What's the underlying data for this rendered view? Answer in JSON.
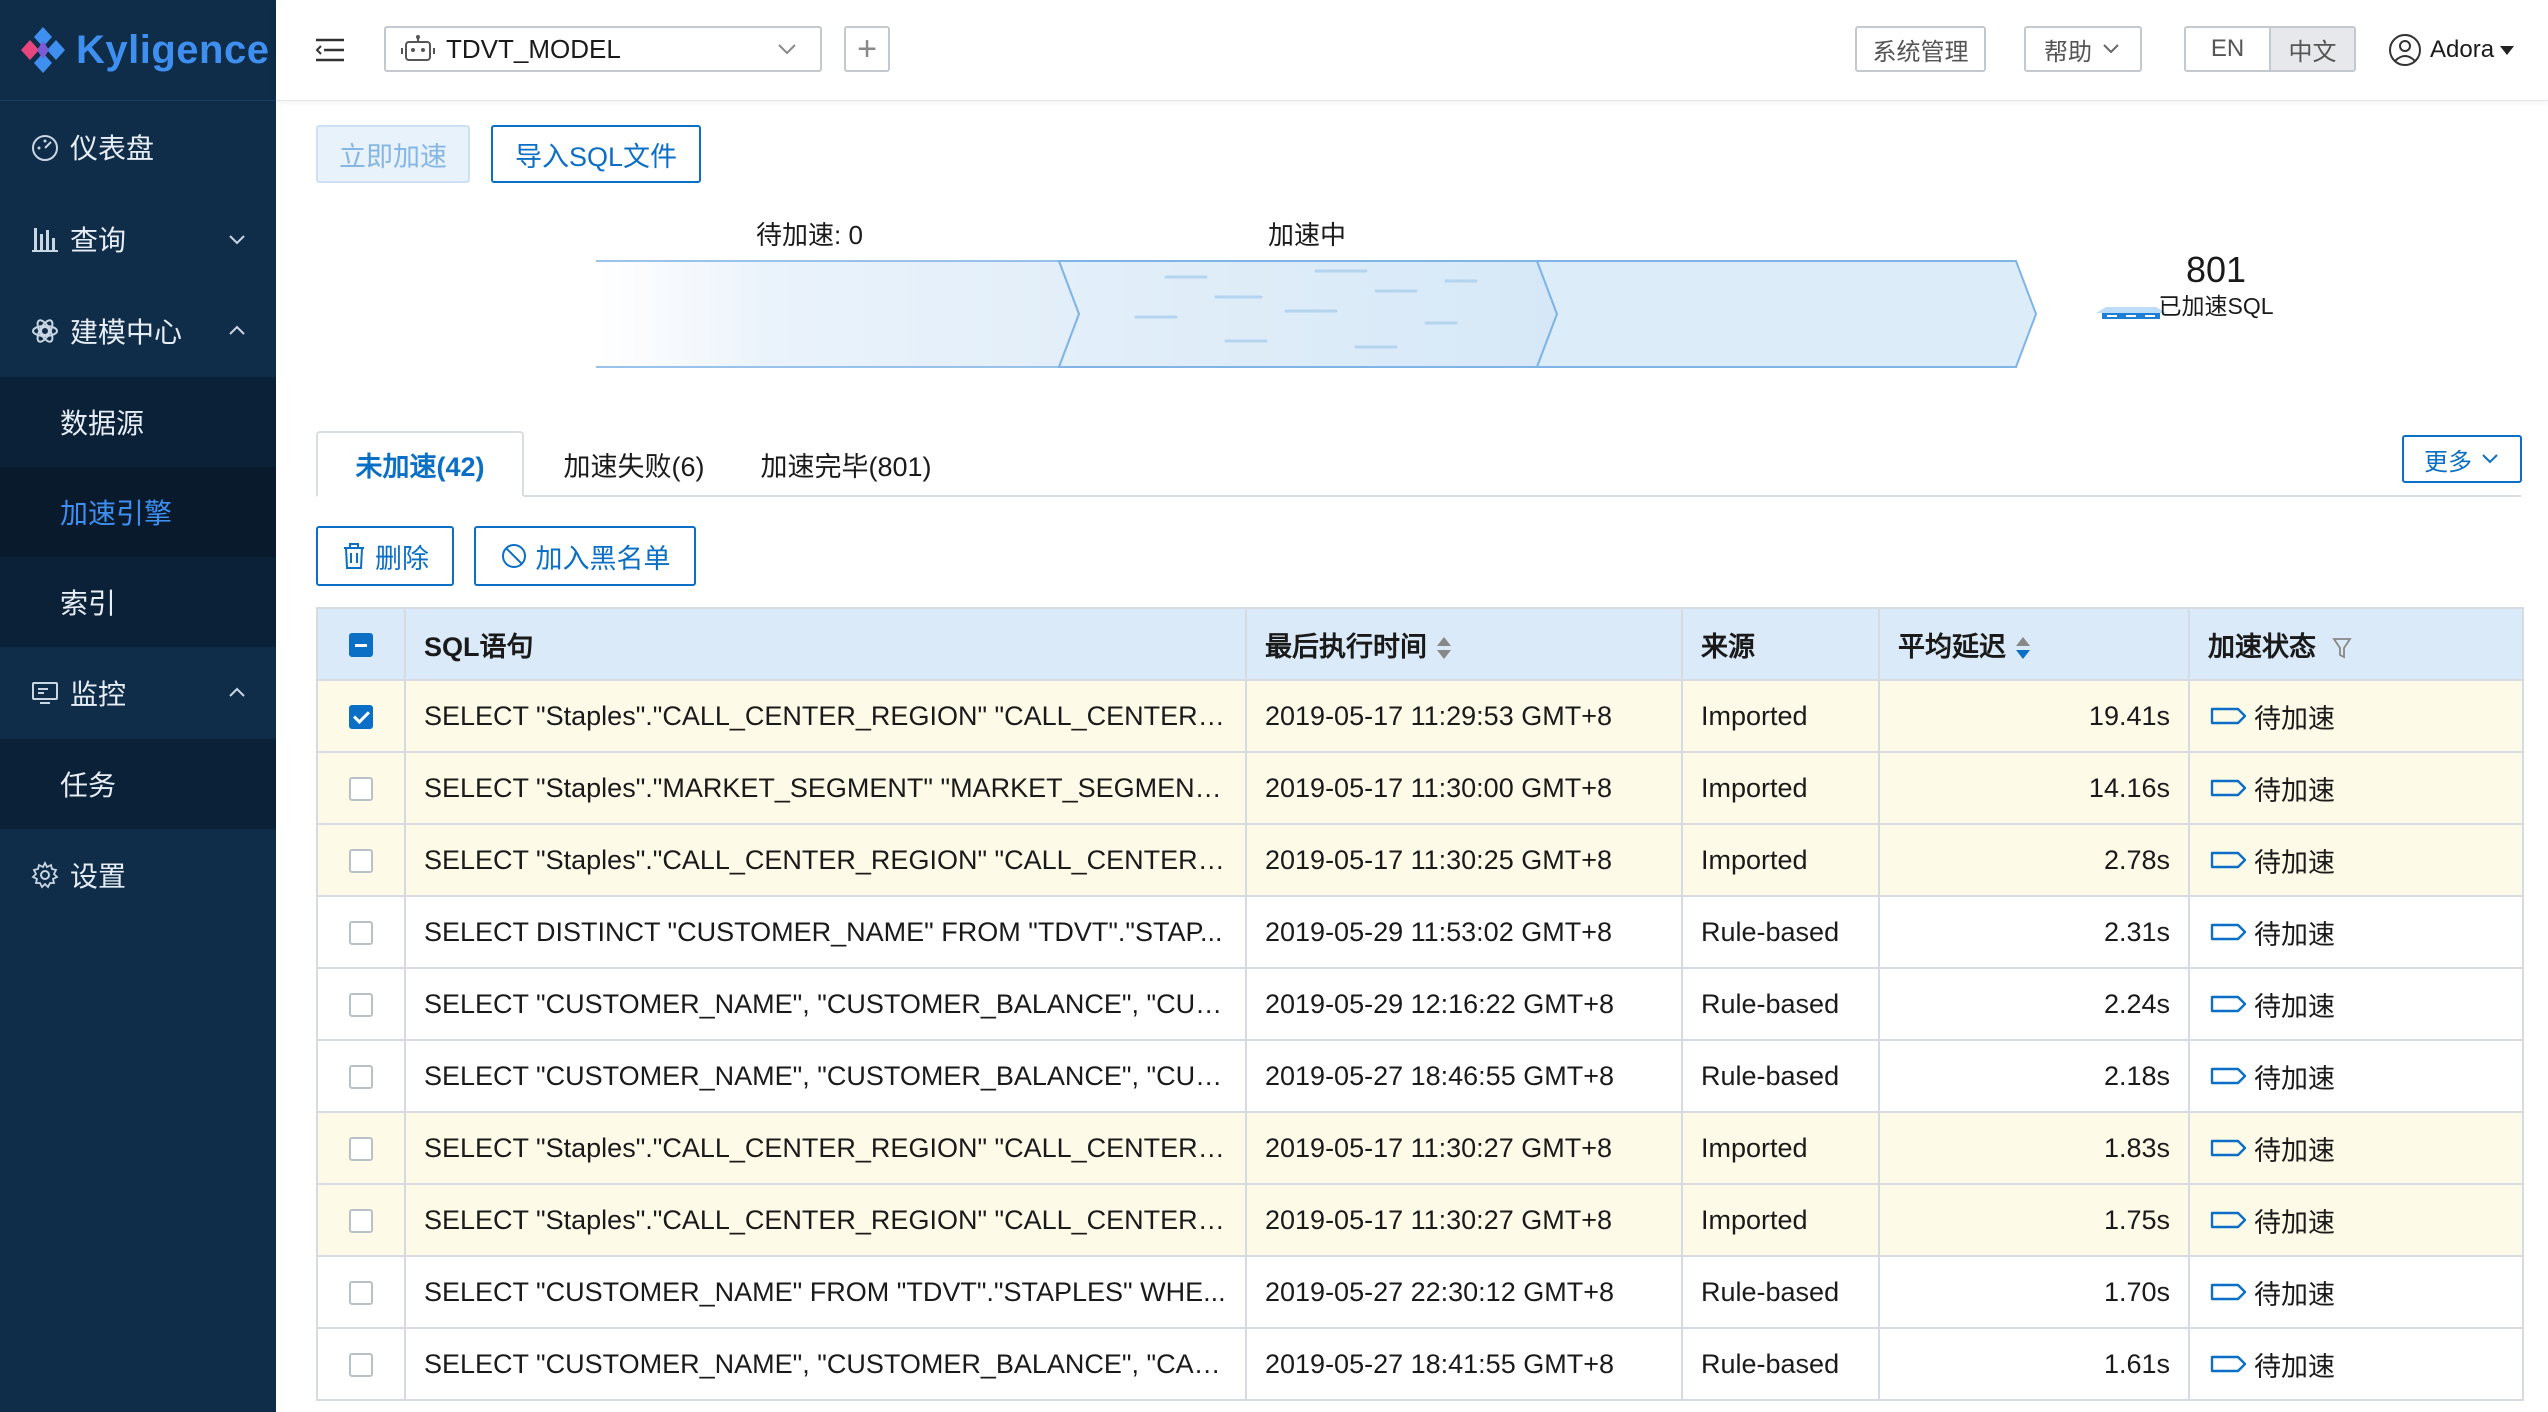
{
  "brand": {
    "name": "Kyligence"
  },
  "sidebar": {
    "items": [
      {
        "label": "仪表盘",
        "icon": "dashboard-icon"
      },
      {
        "label": "查询",
        "icon": "bar-chart-icon",
        "chevron": "down"
      },
      {
        "label": "建模中心",
        "icon": "model-center-icon",
        "chevron": "up"
      },
      {
        "label": "数据源",
        "sub": true
      },
      {
        "label": "加速引擎",
        "sub": true,
        "active": true
      },
      {
        "label": "索引",
        "sub": true
      },
      {
        "label": "监控",
        "icon": "monitor-icon",
        "chevron": "up"
      },
      {
        "label": "任务",
        "sub": true
      },
      {
        "label": "设置",
        "icon": "gear-icon"
      }
    ]
  },
  "header": {
    "model": "TDVT_MODEL",
    "add": "+",
    "system_admin": "系统管理",
    "help": "帮助",
    "lang_en": "EN",
    "lang_zh": "中文",
    "user": "Adora"
  },
  "toolbar": {
    "accelerate_now": "立即加速",
    "import_sql": "导入SQL文件"
  },
  "flow": {
    "pending_label": "待加速: 0",
    "accelerating_label": "加速中",
    "accelerated_count": "801",
    "accelerated_label": "已加速SQL"
  },
  "tabs": {
    "not_accelerated": "未加速(42)",
    "failed": "加速失败(6)",
    "completed": "加速完毕(801)",
    "more": "更多"
  },
  "actions": {
    "delete": "删除",
    "blacklist": "加入黑名单"
  },
  "colors": {
    "sidebar_bg": "#0f2c48",
    "accent": "#0b6fc5",
    "row_highlight": "#fdfae8",
    "table_header": "#dbeaf8"
  },
  "table": {
    "columns": [
      "SQL语句",
      "最后执行时间",
      "来源",
      "平均延迟",
      "加速状态"
    ],
    "rows": [
      {
        "checked": true,
        "highlight": true,
        "sql": "SELECT \"Staples\".\"CALL_CENTER_REGION\" \"CALL_CENTER_R...",
        "time": "2019-05-17 11:29:53 GMT+8",
        "source": "Imported",
        "latency": "19.41s",
        "status": "待加速"
      },
      {
        "checked": false,
        "highlight": true,
        "sql": "SELECT \"Staples\".\"MARKET_SEGMENT\" \"MARKET_SEGMENT\"...",
        "time": "2019-05-17 11:30:00 GMT+8",
        "source": "Imported",
        "latency": "14.16s",
        "status": "待加速"
      },
      {
        "checked": false,
        "highlight": true,
        "sql": "SELECT \"Staples\".\"CALL_CENTER_REGION\" \"CALL_CENTER_R...",
        "time": "2019-05-17 11:30:25 GMT+8",
        "source": "Imported",
        "latency": "2.78s",
        "status": "待加速"
      },
      {
        "checked": false,
        "highlight": false,
        "sql": "SELECT DISTINCT \"CUSTOMER_NAME\" FROM \"TDVT\".\"STAP...",
        "time": "2019-05-29 11:53:02 GMT+8",
        "source": "Rule-based",
        "latency": "2.31s",
        "status": "待加速"
      },
      {
        "checked": false,
        "highlight": false,
        "sql": "SELECT \"CUSTOMER_NAME\", \"CUSTOMER_BALANCE\", \"CUS...",
        "time": "2019-05-29 12:16:22 GMT+8",
        "source": "Rule-based",
        "latency": "2.24s",
        "status": "待加速"
      },
      {
        "checked": false,
        "highlight": false,
        "sql": "SELECT \"CUSTOMER_NAME\", \"CUSTOMER_BALANCE\", \"CUS...",
        "time": "2019-05-27 18:46:55 GMT+8",
        "source": "Rule-based",
        "latency": "2.18s",
        "status": "待加速"
      },
      {
        "checked": false,
        "highlight": true,
        "sql": "SELECT \"Staples\".\"CALL_CENTER_REGION\" \"CALL_CENTER_R...",
        "time": "2019-05-17 11:30:27 GMT+8",
        "source": "Imported",
        "latency": "1.83s",
        "status": "待加速"
      },
      {
        "checked": false,
        "highlight": true,
        "sql": "SELECT \"Staples\".\"CALL_CENTER_REGION\" \"CALL_CENTER_R...",
        "time": "2019-05-17 11:30:27 GMT+8",
        "source": "Imported",
        "latency": "1.75s",
        "status": "待加速"
      },
      {
        "checked": false,
        "highlight": false,
        "sql": "SELECT \"CUSTOMER_NAME\" FROM \"TDVT\".\"STAPLES\" WHE...",
        "time": "2019-05-27 22:30:12 GMT+8",
        "source": "Rule-based",
        "latency": "1.70s",
        "status": "待加速"
      },
      {
        "checked": false,
        "highlight": false,
        "sql": "SELECT \"CUSTOMER_NAME\", \"CUSTOMER_BALANCE\", \"CAL...",
        "time": "2019-05-27 18:41:55 GMT+8",
        "source": "Rule-based",
        "latency": "1.61s",
        "status": "待加速"
      }
    ]
  }
}
